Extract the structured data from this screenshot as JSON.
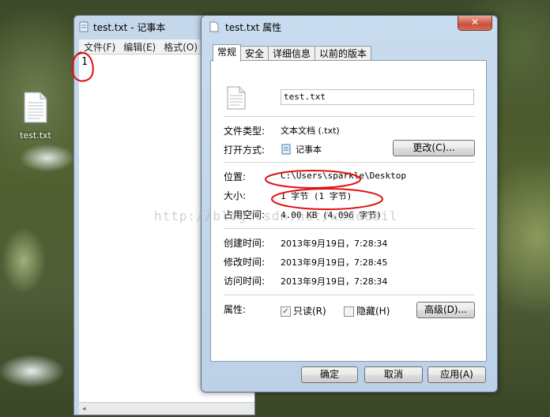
{
  "desktop": {
    "icon_label": "test.txt"
  },
  "notepad": {
    "title": "test.txt - 记事本",
    "menu": [
      "文件(F)",
      "编辑(E)",
      "格式(O)"
    ],
    "content": "1"
  },
  "dialog": {
    "title": "test.txt 属性",
    "close_label": "✕",
    "tabs": [
      "常规",
      "安全",
      "详细信息",
      "以前的版本"
    ],
    "file_name": "test.txt",
    "type_label": "文件类型:",
    "type_value": "文本文档 (.txt)",
    "open_label": "打开方式:",
    "open_value": "记事本",
    "change_button": "更改(C)...",
    "location_label": "位置:",
    "location_value": "C:\\Users\\sparkle\\Desktop",
    "size_label": "大小:",
    "size_value": "1 字节 (1 字节)",
    "disk_label": "占用空间:",
    "disk_value": "4.00 KB (4,096 字节)",
    "created_label": "创建时间:",
    "created_value": "2013年9月19日，7:28:34",
    "modified_label": "修改时间:",
    "modified_value": "2013年9月19日，7:28:45",
    "accessed_label": "访问时间:",
    "accessed_value": "2013年9月19日，7:28:34",
    "attr_label": "属性:",
    "readonly_label": "只读(R)",
    "readonly_checked": true,
    "hidden_label": "隐藏(H)",
    "hidden_checked": false,
    "advanced_button": "高级(D)...",
    "ok_button": "确定",
    "cancel_button": "取消",
    "apply_button": "应用(A)"
  },
  "watermark": "http://blog.csdn.net/xxdddail",
  "colors": {
    "annotation": "#e01010",
    "title_bar": "#c9dcef"
  }
}
